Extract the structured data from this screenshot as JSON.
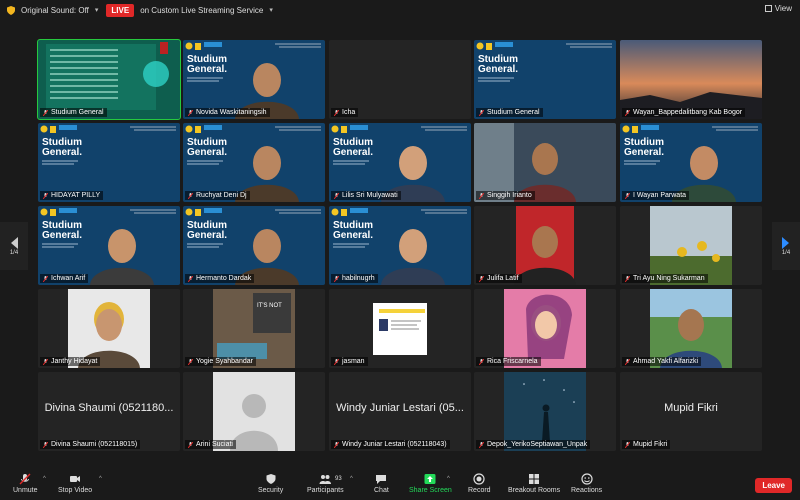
{
  "topbar": {
    "original_sound": "Original Sound: Off",
    "live_badge": "LIVE",
    "stream_label": "on Custom Live Streaming Service",
    "view_label": "View"
  },
  "pagination": {
    "left": "1/4",
    "right": "1/4"
  },
  "participants": [
    {
      "name": "Studium General",
      "type": "slide-screen"
    },
    {
      "name": "Novida Waskitaningsih",
      "type": "slide-person"
    },
    {
      "name": "Icha",
      "type": "blank"
    },
    {
      "name": "Studium General",
      "type": "slide"
    },
    {
      "name": "Wayan_Bappedalitbang Kab Bogor",
      "type": "sky"
    },
    {
      "name": "HIDAYAT PILLY",
      "type": "slide"
    },
    {
      "name": "Ruchyat Deni Dj",
      "type": "slide-person"
    },
    {
      "name": "Lilis Sri Mulyawati",
      "type": "slide-person"
    },
    {
      "name": "Singgih Irianto",
      "type": "person"
    },
    {
      "name": "I Wayan Parwata",
      "type": "slide-person"
    },
    {
      "name": "Ichwan Arif",
      "type": "slide-person"
    },
    {
      "name": "Hermanto Dardak",
      "type": "slide-person"
    },
    {
      "name": "habilnugrh",
      "type": "slide-person"
    },
    {
      "name": "Julifa Latif",
      "type": "person-red"
    },
    {
      "name": "Tri Ayu Ning Sukarman",
      "type": "sunflower"
    },
    {
      "name": "Janthy Hidayat",
      "type": "person-white"
    },
    {
      "name": "Yogie Syahbandar",
      "type": "room"
    },
    {
      "name": "jasman",
      "type": "card"
    },
    {
      "name": "Rica Friscarnela",
      "type": "art"
    },
    {
      "name": "Ahmad Yakfi Alfarizki",
      "type": "outdoor"
    },
    {
      "name": "Divina Shaumi (052118015)",
      "type": "name",
      "big": "Divina Shaumi (0521180..."
    },
    {
      "name": "Arini Suciati",
      "type": "avatar"
    },
    {
      "name": "Windy Juniar Lestari (052118043)",
      "type": "name",
      "big": "Windy Juniar Lestari (05..."
    },
    {
      "name": "Depok_YerikoSeptiawan_Unpak",
      "type": "night"
    },
    {
      "name": "Mupid Fikri",
      "type": "name",
      "big": "Mupid Fikri"
    }
  ],
  "slide_text": "Studium General.",
  "toolbar": {
    "unmute": "Unmute",
    "stop_video": "Stop Video",
    "security": "Security",
    "participants": "Participants",
    "participants_count": "93",
    "chat": "Chat",
    "share_screen": "Share Screen",
    "record": "Record",
    "breakout": "Breakout Rooms",
    "reactions": "Reactions",
    "leave": "Leave"
  },
  "colors": {
    "accent_green": "#27c93f",
    "live_red": "#e02828",
    "share_green": "#23d959"
  }
}
